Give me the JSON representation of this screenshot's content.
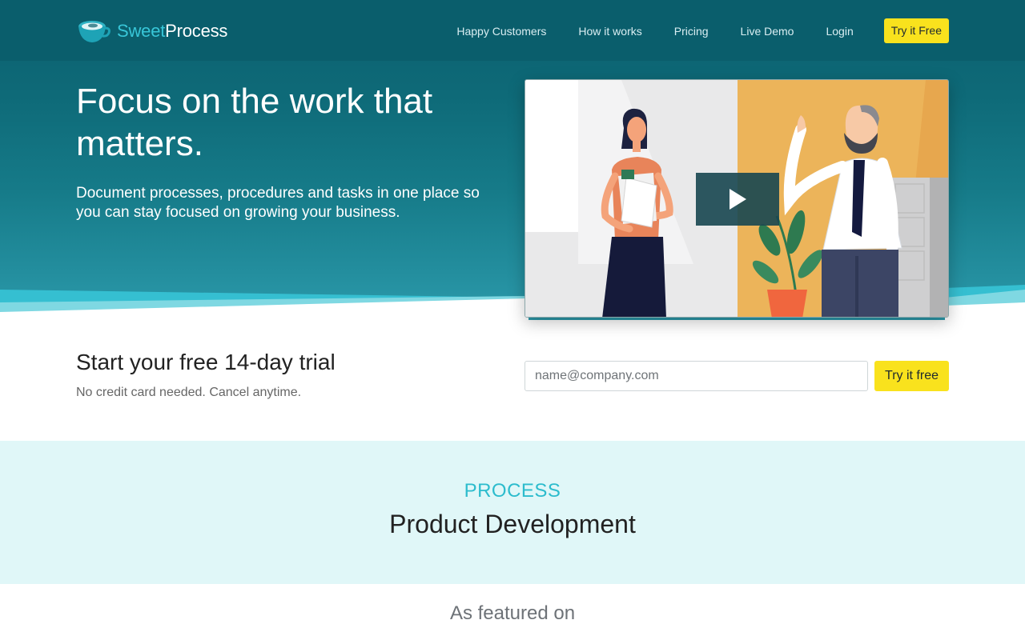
{
  "brand": {
    "name_part1": "Sweet",
    "name_part2": "Process",
    "icon": "coffee-cup-logo-icon"
  },
  "nav": {
    "links": [
      "Happy Customers",
      "How it works",
      "Pricing",
      "Live Demo",
      "Login"
    ],
    "cta": "Try it Free"
  },
  "hero": {
    "title": "Focus on the work that matters.",
    "subtitle": "Document processes, procedures and tasks in one place so you can stay focused on growing your business.",
    "video_play_icon": "play-icon"
  },
  "trial": {
    "title": "Start your free 14-day trial",
    "subtitle": "No credit card needed. Cancel anytime.",
    "email_placeholder": "name@company.com",
    "email_value": "",
    "button": "Try it free"
  },
  "process": {
    "kicker": "PROCESS",
    "title": "Product Development"
  },
  "featured": {
    "title": "As featured on"
  },
  "colors": {
    "nav_bg": "#0a5e6c",
    "brand_cyan": "#38c6d8",
    "cta_yellow": "#f9e21d",
    "process_band": "#e0f7f8"
  }
}
